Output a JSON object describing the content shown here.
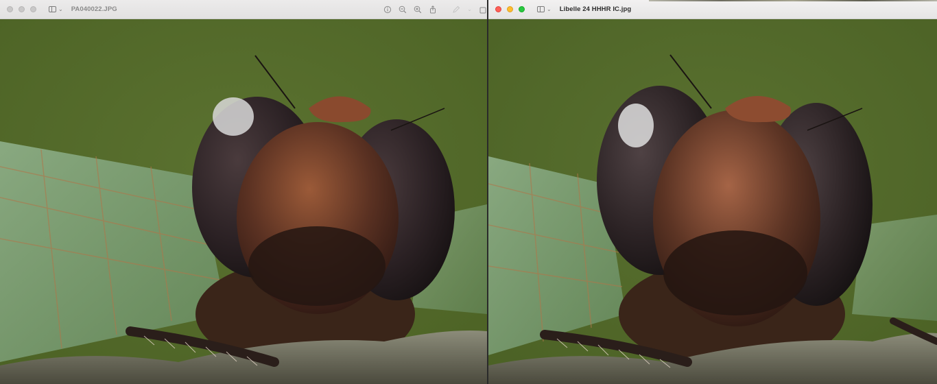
{
  "left_window": {
    "title": "PA040022.JPG",
    "toolbar": {
      "info_icon": "info-icon",
      "zoom_out_icon": "zoom-out-icon",
      "zoom_in_icon": "zoom-in-icon",
      "share_icon": "share-icon",
      "markup_icon": "markup-pen-icon",
      "rotate_icon": "rotate-icon"
    }
  },
  "right_window": {
    "title": "Libelle 24 HHHR IC.jpg"
  },
  "colors": {
    "background_green": "#556b29",
    "traffic_red": "#fe5f57",
    "traffic_yellow": "#febc2e",
    "traffic_green": "#28c840"
  }
}
